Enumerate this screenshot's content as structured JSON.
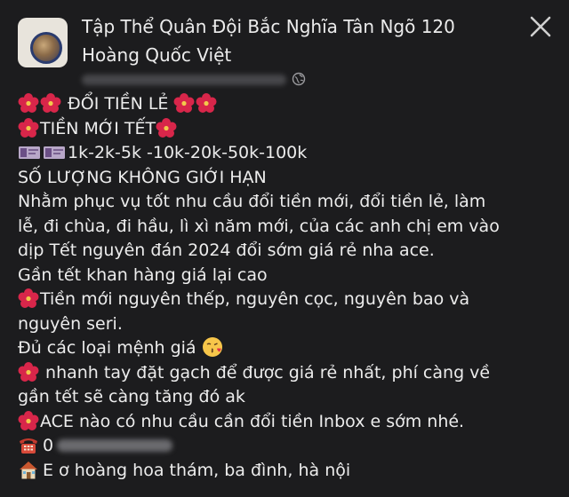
{
  "header": {
    "group_name": "Tập Thể Quân Đội Bắc Nghĩa Tân Ngõ 120 Hoàng Quốc Việt",
    "close_icon": "close-icon",
    "privacy_icon": "globe-icon"
  },
  "post": {
    "line1": "ĐỔI TIỀN LẺ",
    "line2": "TIỀN MỚI TẾT",
    "line3": "1k-2k-5k -10k-20k-50k-100k",
    "line4": "SỐ LƯỢNG KHÔNG GIỚI HẠN",
    "line5": "Nhằm phục vụ tốt nhu cầu đổi tiền mới, đổi tiền lẻ, làm",
    "line6": "lễ, đi chùa, đi hầu, lì xì năm mới, của các anh chị em vào",
    "line7": "dịp Tết nguyên đán 2024 đổi sớm giá rẻ nha ace.",
    "line8": "Gần tết khan hàng giá lại cao",
    "line9": "Tiền mới nguyên thếp, nguyên cọc, nguyên bao và",
    "line10": "nguyên seri.",
    "line11": "Đủ các loại mệnh giá",
    "line12": " nhanh tay đặt gạch để được giá rẻ nhất, phí càng về",
    "line13": "gần tết sẽ càng tăng đó ak",
    "line14": "ACE nào có nhu cầu cần đổi tiền Inbox e sớm nhé.",
    "line15": "0",
    "line16": "E ơ hoàng hoa thám, ba đình, hà nội"
  },
  "colors": {
    "background": "#1c1c1e",
    "text": "#ececec",
    "flower": "#d8264a"
  }
}
